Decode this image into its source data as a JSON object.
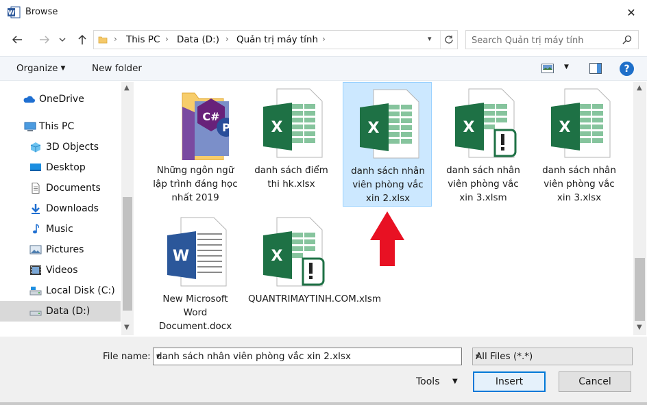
{
  "window": {
    "title": "Browse",
    "close_glyph": "✕"
  },
  "address": {
    "crumbs": [
      "This PC",
      "Data (D:)",
      "Quản trị máy tính"
    ]
  },
  "search": {
    "placeholder": "Search Quản trị máy tính"
  },
  "toolbar": {
    "organize_label": "Organize",
    "new_folder_label": "New folder",
    "help_label": "?"
  },
  "nav": {
    "items": [
      {
        "label": "OneDrive",
        "icon": "cloud-icon"
      },
      {
        "label": "This PC",
        "icon": "computer-icon"
      },
      {
        "label": "3D Objects",
        "icon": "cube-icon"
      },
      {
        "label": "Desktop",
        "icon": "desktop-icon"
      },
      {
        "label": "Documents",
        "icon": "document-icon"
      },
      {
        "label": "Downloads",
        "icon": "download-icon"
      },
      {
        "label": "Music",
        "icon": "music-note-icon"
      },
      {
        "label": "Pictures",
        "icon": "picture-icon"
      },
      {
        "label": "Videos",
        "icon": "video-icon"
      },
      {
        "label": "Local Disk (C:)",
        "icon": "drive-icon"
      },
      {
        "label": "Data (D:)",
        "icon": "drive-icon",
        "selected": true
      }
    ]
  },
  "files": [
    {
      "name": "Những ngôn ngữ lập trình đáng học nhất 2019",
      "type": "folder"
    },
    {
      "name": "danh sách điểm thi hk.xlsx",
      "type": "xlsx"
    },
    {
      "name": "danh sách nhân viên phòng vắc xin 2.xlsx",
      "type": "xlsx",
      "selected": true
    },
    {
      "name": "danh sách nhân viên phòng vắc xin 3.xlsm",
      "type": "xlsm"
    },
    {
      "name": "danh sách nhân viên phòng vắc xin 3.xlsx",
      "type": "xlsx"
    },
    {
      "name": "New Microsoft Word Document.docx",
      "type": "docx"
    },
    {
      "name": "QUANTRIMAYTINH.COM.xlsm",
      "type": "xlsm"
    }
  ],
  "bottom": {
    "file_name_label": "File name:",
    "file_name_value": "danh sách nhân viên phòng vắc xin 2.xlsx",
    "file_type_value": "All Files (*.*)",
    "tools_label": "Tools",
    "insert_label": "Insert",
    "cancel_label": "Cancel"
  },
  "colors": {
    "accent": "#0078d7",
    "selection": "#cce8ff",
    "excel_green": "#1e7145",
    "word_blue": "#2b579a",
    "arrow_red": "#e81123"
  }
}
